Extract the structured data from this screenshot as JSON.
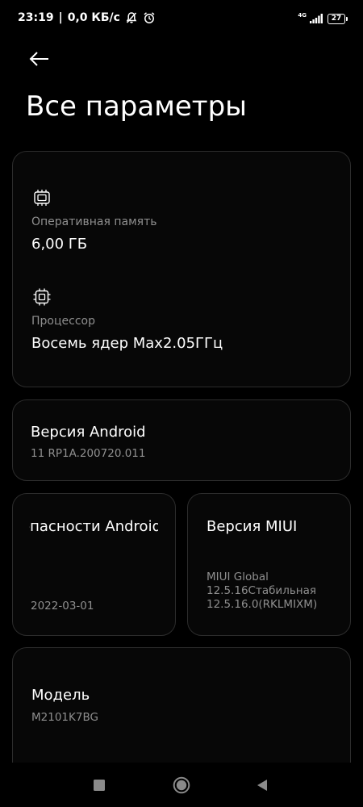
{
  "status_bar": {
    "time": "23:19",
    "separator": "|",
    "net_speed": "0,0 КБ/с",
    "network_type": "4G",
    "battery_level": "27"
  },
  "icons": {
    "back": "arrow-left-icon",
    "mute": "bell-off-icon",
    "alarm": "alarm-clock-icon",
    "signal": "signal-bars-icon",
    "battery": "battery-icon",
    "ram": "chip-icon",
    "cpu": "processor-icon"
  },
  "header": {
    "title": "Все параметры"
  },
  "specs": {
    "ram_label": "Оперативная память",
    "ram_value": "6,00 ГБ",
    "cpu_label": "Процессор",
    "cpu_value": "Восемь ядер Max2.05ГГц"
  },
  "android": {
    "title": "Версия Android",
    "value": "11 RP1A.200720.011"
  },
  "security": {
    "title": "Уровень безопасности Android",
    "value": "2022-03-01"
  },
  "miui": {
    "title": "Версия MIUI",
    "line1": "MIUI Global",
    "line2": "12.5.16Стабильная",
    "line3": "12.5.16.0(RKLMIXM)"
  },
  "model": {
    "title": "Модель",
    "value": "M2101K7BG"
  },
  "colors": {
    "background": "#000000",
    "card_border": "#2c2c2c",
    "secondary_text": "#8f8f8f",
    "nav_icon": "#8a8a8a"
  }
}
